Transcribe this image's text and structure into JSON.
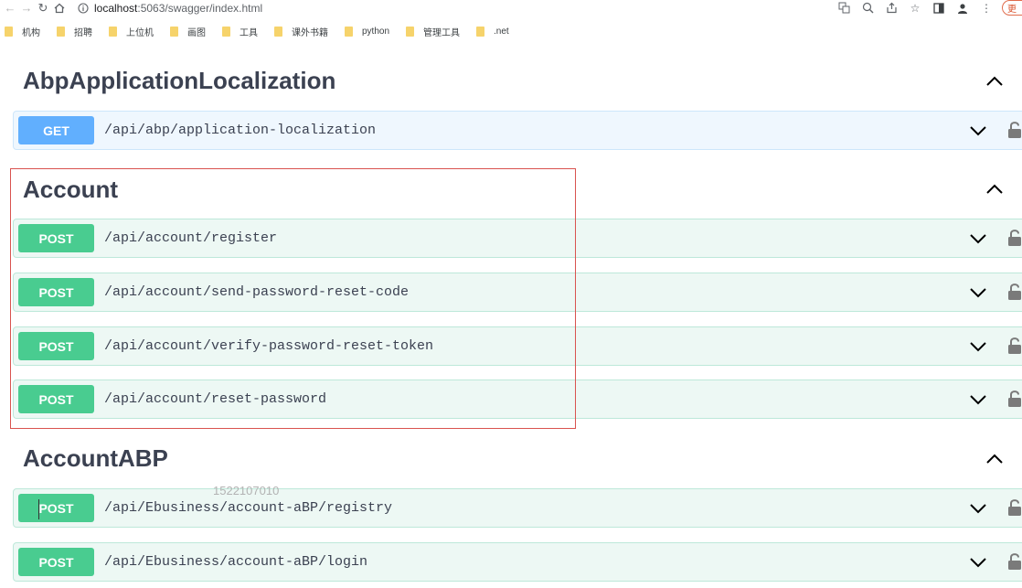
{
  "browser": {
    "url_host": "localhost",
    "url_port_path": ":5063/swagger/index.html",
    "update_label": "更"
  },
  "bookmarks": [
    {
      "label": "机构"
    },
    {
      "label": "招聘"
    },
    {
      "label": "上位机"
    },
    {
      "label": "画图"
    },
    {
      "label": "工具"
    },
    {
      "label": "课外书籍"
    },
    {
      "label": "python"
    },
    {
      "label": "管理工具"
    },
    {
      "label": ".net"
    }
  ],
  "sections": [
    {
      "title": "AbpApplicationLocalization",
      "operations": [
        {
          "method": "GET",
          "path": "/api/abp/application-localization"
        }
      ]
    },
    {
      "title": "Account",
      "operations": [
        {
          "method": "POST",
          "path": "/api/account/register"
        },
        {
          "method": "POST",
          "path": "/api/account/send-password-reset-code"
        },
        {
          "method": "POST",
          "path": "/api/account/verify-password-reset-token"
        },
        {
          "method": "POST",
          "path": "/api/account/reset-password"
        }
      ]
    },
    {
      "title": "AccountABP",
      "operations": [
        {
          "method": "POST",
          "path": "/api/Ebusiness/account-aBP/registry"
        },
        {
          "method": "POST",
          "path": "/api/Ebusiness/account-aBP/login"
        }
      ]
    }
  ],
  "watermark": "1522107010",
  "colors": {
    "get": "#61affe",
    "post": "#49cc90",
    "highlight_border": "#d9534f"
  }
}
